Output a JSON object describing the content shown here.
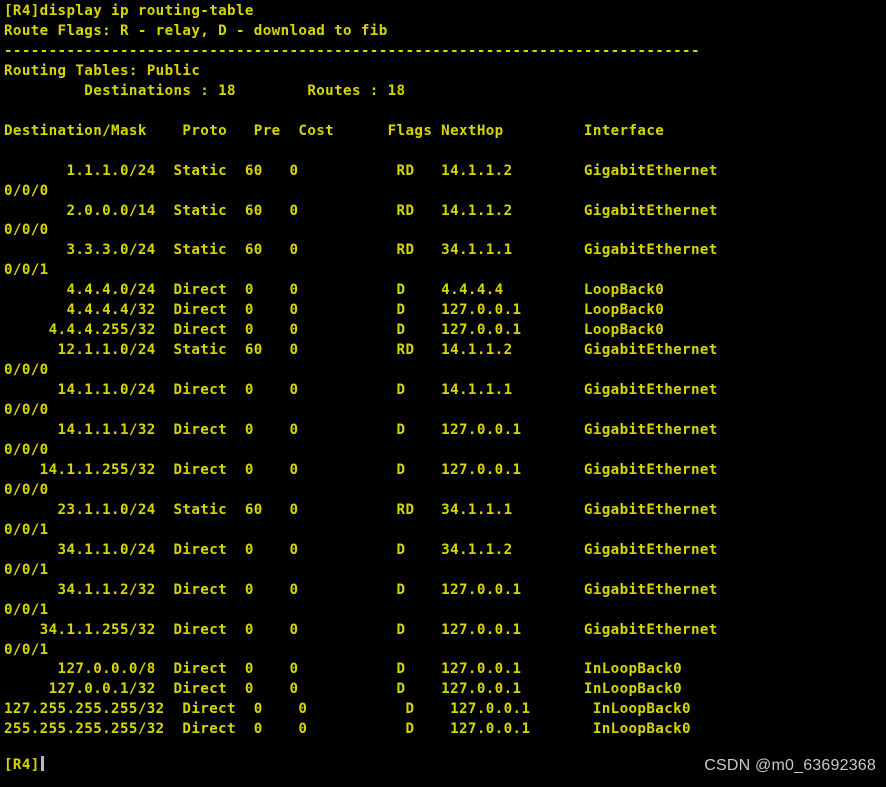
{
  "terminal": {
    "colors": {
      "background": "#000000",
      "foreground": "#d7d700",
      "cursor": "#b9b9b9",
      "watermark": "#c9c9c9"
    },
    "command_line": "[R4]display ip routing-table",
    "route_flags_line": "Route Flags: R - relay, D - download to fib",
    "separator": "------------------------------------------------------------------------------",
    "routing_tables_line": "Routing Tables: Public",
    "summary_line": "         Destinations : 18        Routes : 18",
    "summary": {
      "destinations_label": "Destinations",
      "destinations_value": "18",
      "routes_label": "Routes",
      "routes_value": "18"
    },
    "columns": [
      "Destination/Mask",
      "Proto",
      "Pre",
      "Cost",
      "Flags",
      "NextHop",
      "Interface"
    ],
    "header_line": "Destination/Mask    Proto   Pre  Cost      Flags NextHop         Interface",
    "routes": [
      {
        "destination": "1.1.1.0/24",
        "proto": "Static",
        "pre": "60",
        "cost": "0",
        "flags": "RD",
        "nexthop": "14.1.1.2",
        "interface": "GigabitEthernet",
        "interface_cont": "0/0/0"
      },
      {
        "destination": "2.0.0.0/14",
        "proto": "Static",
        "pre": "60",
        "cost": "0",
        "flags": "RD",
        "nexthop": "14.1.1.2",
        "interface": "GigabitEthernet",
        "interface_cont": "0/0/0"
      },
      {
        "destination": "3.3.3.0/24",
        "proto": "Static",
        "pre": "60",
        "cost": "0",
        "flags": "RD",
        "nexthop": "34.1.1.1",
        "interface": "GigabitEthernet",
        "interface_cont": "0/0/1"
      },
      {
        "destination": "4.4.4.0/24",
        "proto": "Direct",
        "pre": "0",
        "cost": "0",
        "flags": "D",
        "nexthop": "4.4.4.4",
        "interface": "LoopBack0",
        "interface_cont": ""
      },
      {
        "destination": "4.4.4.4/32",
        "proto": "Direct",
        "pre": "0",
        "cost": "0",
        "flags": "D",
        "nexthop": "127.0.0.1",
        "interface": "LoopBack0",
        "interface_cont": ""
      },
      {
        "destination": "4.4.4.255/32",
        "proto": "Direct",
        "pre": "0",
        "cost": "0",
        "flags": "D",
        "nexthop": "127.0.0.1",
        "interface": "LoopBack0",
        "interface_cont": ""
      },
      {
        "destination": "12.1.1.0/24",
        "proto": "Static",
        "pre": "60",
        "cost": "0",
        "flags": "RD",
        "nexthop": "14.1.1.2",
        "interface": "GigabitEthernet",
        "interface_cont": "0/0/0"
      },
      {
        "destination": "14.1.1.0/24",
        "proto": "Direct",
        "pre": "0",
        "cost": "0",
        "flags": "D",
        "nexthop": "14.1.1.1",
        "interface": "GigabitEthernet",
        "interface_cont": "0/0/0"
      },
      {
        "destination": "14.1.1.1/32",
        "proto": "Direct",
        "pre": "0",
        "cost": "0",
        "flags": "D",
        "nexthop": "127.0.0.1",
        "interface": "GigabitEthernet",
        "interface_cont": "0/0/0"
      },
      {
        "destination": "14.1.1.255/32",
        "proto": "Direct",
        "pre": "0",
        "cost": "0",
        "flags": "D",
        "nexthop": "127.0.0.1",
        "interface": "GigabitEthernet",
        "interface_cont": "0/0/0"
      },
      {
        "destination": "23.1.1.0/24",
        "proto": "Static",
        "pre": "60",
        "cost": "0",
        "flags": "RD",
        "nexthop": "34.1.1.1",
        "interface": "GigabitEthernet",
        "interface_cont": "0/0/1"
      },
      {
        "destination": "34.1.1.0/24",
        "proto": "Direct",
        "pre": "0",
        "cost": "0",
        "flags": "D",
        "nexthop": "34.1.1.2",
        "interface": "GigabitEthernet",
        "interface_cont": "0/0/1"
      },
      {
        "destination": "34.1.1.2/32",
        "proto": "Direct",
        "pre": "0",
        "cost": "0",
        "flags": "D",
        "nexthop": "127.0.0.1",
        "interface": "GigabitEthernet",
        "interface_cont": "0/0/1"
      },
      {
        "destination": "34.1.1.255/32",
        "proto": "Direct",
        "pre": "0",
        "cost": "0",
        "flags": "D",
        "nexthop": "127.0.0.1",
        "interface": "GigabitEthernet",
        "interface_cont": "0/0/1"
      },
      {
        "destination": "127.0.0.0/8",
        "proto": "Direct",
        "pre": "0",
        "cost": "0",
        "flags": "D",
        "nexthop": "127.0.0.1",
        "interface": "InLoopBack0",
        "interface_cont": ""
      },
      {
        "destination": "127.0.0.1/32",
        "proto": "Direct",
        "pre": "0",
        "cost": "0",
        "flags": "D",
        "nexthop": "127.0.0.1",
        "interface": "InLoopBack0",
        "interface_cont": ""
      },
      {
        "destination": "127.255.255.255/32",
        "proto": "Direct",
        "pre": "0",
        "cost": "0",
        "flags": "D",
        "nexthop": "127.0.0.1",
        "interface": "InLoopBack0",
        "interface_cont": ""
      },
      {
        "destination": "255.255.255.255/32",
        "proto": "Direct",
        "pre": "0",
        "cost": "0",
        "flags": "D",
        "nexthop": "127.0.0.1",
        "interface": "InLoopBack0",
        "interface_cont": ""
      }
    ],
    "screen_text": "[R4]display ip routing-table\nRoute Flags: R - relay, D - download to fib\n------------------------------------------------------------------------------\nRouting Tables: Public\n         Destinations : 18        Routes : 18\n\nDestination/Mask    Proto   Pre  Cost      Flags NextHop         Interface\n\n       1.1.1.0/24  Static  60   0           RD   14.1.1.2        GigabitEthernet\n0/0/0\n       2.0.0.0/14  Static  60   0           RD   14.1.1.2        GigabitEthernet\n0/0/0\n       3.3.3.0/24  Static  60   0           RD   34.1.1.1        GigabitEthernet\n0/0/1\n       4.4.4.0/24  Direct  0    0           D    4.4.4.4         LoopBack0\n       4.4.4.4/32  Direct  0    0           D    127.0.0.1       LoopBack0\n     4.4.4.255/32  Direct  0    0           D    127.0.0.1       LoopBack0\n      12.1.1.0/24  Static  60   0           RD   14.1.1.2        GigabitEthernet\n0/0/0\n      14.1.1.0/24  Direct  0    0           D    14.1.1.1        GigabitEthernet\n0/0/0\n      14.1.1.1/32  Direct  0    0           D    127.0.0.1       GigabitEthernet\n0/0/0\n    14.1.1.255/32  Direct  0    0           D    127.0.0.1       GigabitEthernet\n0/0/0\n      23.1.1.0/24  Static  60   0           RD   34.1.1.1        GigabitEthernet\n0/0/1\n      34.1.1.0/24  Direct  0    0           D    34.1.1.2        GigabitEthernet\n0/0/1\n      34.1.1.2/32  Direct  0    0           D    127.0.0.1       GigabitEthernet\n0/0/1\n    34.1.1.255/32  Direct  0    0           D    127.0.0.1       GigabitEthernet\n0/0/1\n      127.0.0.0/8  Direct  0    0           D    127.0.0.1       InLoopBack0\n     127.0.0.1/32  Direct  0    0           D    127.0.0.1       InLoopBack0\n127.255.255.255/32  Direct  0    0           D    127.0.0.1       InLoopBack0\n255.255.255.255/32  Direct  0    0           D    127.0.0.1       InLoopBack0\n",
    "prompt": "[R4]"
  },
  "watermark": {
    "text": "CSDN @m0_63692368"
  }
}
